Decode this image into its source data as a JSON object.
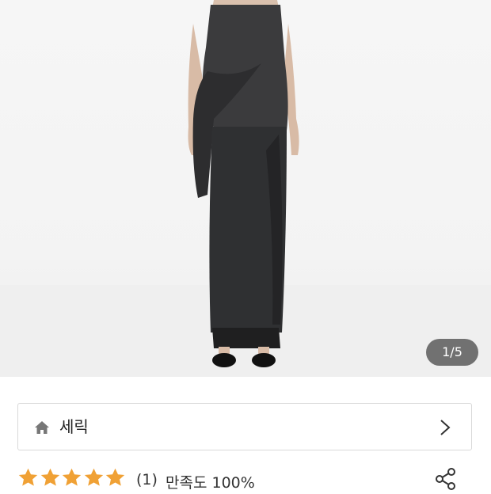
{
  "product": {
    "image_counter": "1/5",
    "image_alt": "model wearing dark strapless draped top and long skirt"
  },
  "brand": {
    "name": "세릭",
    "home_icon": "home-icon",
    "arrow_icon": "chevron-right-icon"
  },
  "rating": {
    "stars": 5,
    "star_color": "#f0a135",
    "count": "(1)",
    "satisfaction": "만족도 100%"
  },
  "share": {
    "icon": "share-icon"
  }
}
